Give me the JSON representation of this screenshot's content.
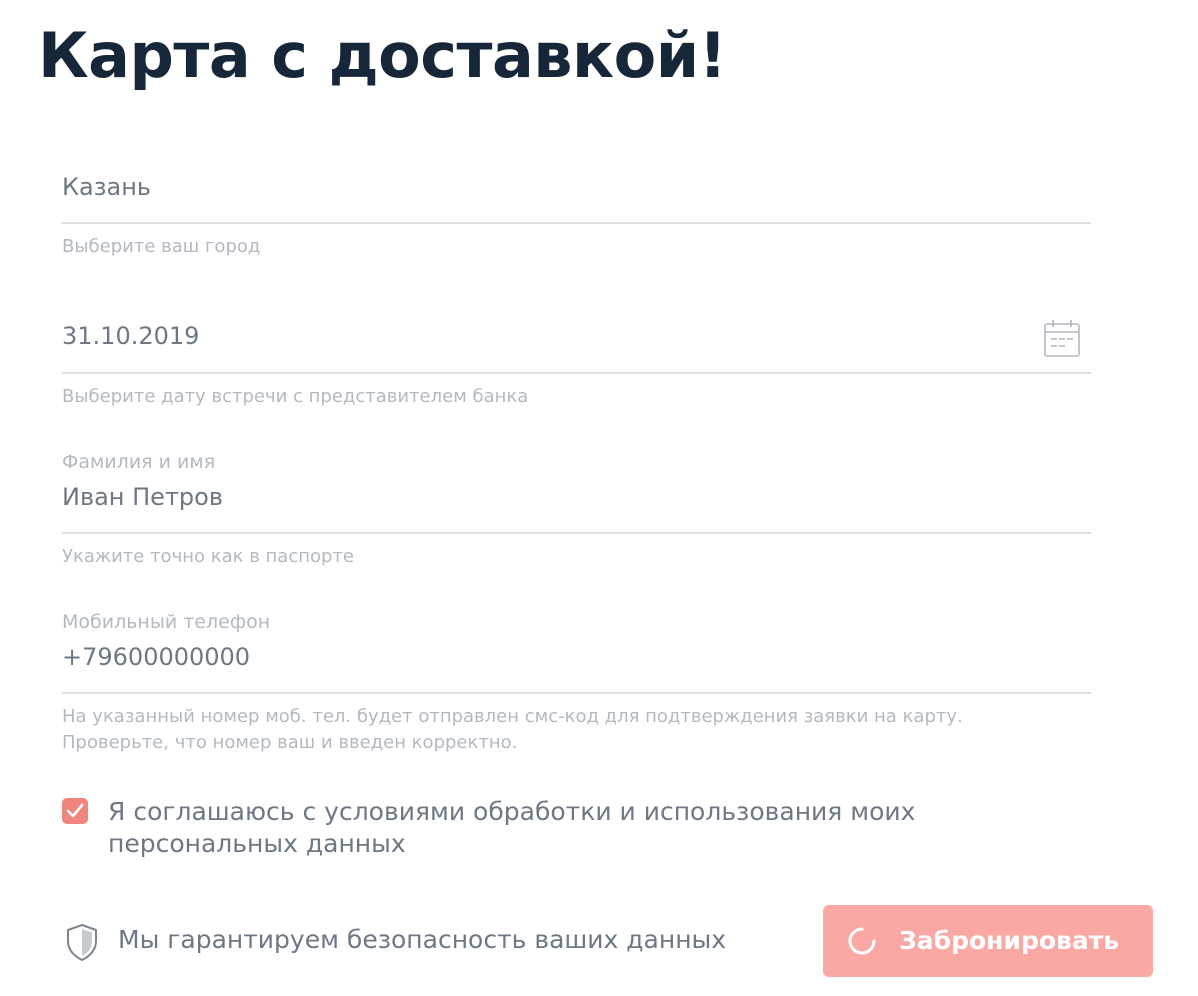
{
  "title": "Карта с доставкой!",
  "form": {
    "city": {
      "value": "Казань",
      "hint": "Выберите ваш город"
    },
    "meeting_date": {
      "value": "31.10.2019",
      "hint": "Выберите дату встречи с представителем банка",
      "icon": "calendar-icon"
    },
    "full_name": {
      "label": "Фамилия и имя",
      "value": "Иван Петров",
      "hint": "Укажите точно как в паспорте"
    },
    "phone": {
      "label": "Мобильный телефон",
      "value": "+79600000000",
      "hint": "На указанный номер моб. тел. будет отправлен смс-код для подтверждения заявки на карту. Проверьте, что номер ваш и введен корректно."
    }
  },
  "consent": {
    "checked": true,
    "text": "Я соглашаюсь с условиями обработки и использования моих персональных данных"
  },
  "security_note": {
    "icon": "shield-icon",
    "text": "Мы гарантируем безопасность ваших данных"
  },
  "submit": {
    "label": "Забронировать",
    "state": "loading"
  },
  "colors": {
    "title": "#152738",
    "value_text": "#6d7884",
    "muted_text": "#b3b9c1",
    "underline": "#dde1e5",
    "checkbox": "#f0857e",
    "button": "#f9a8a4"
  }
}
